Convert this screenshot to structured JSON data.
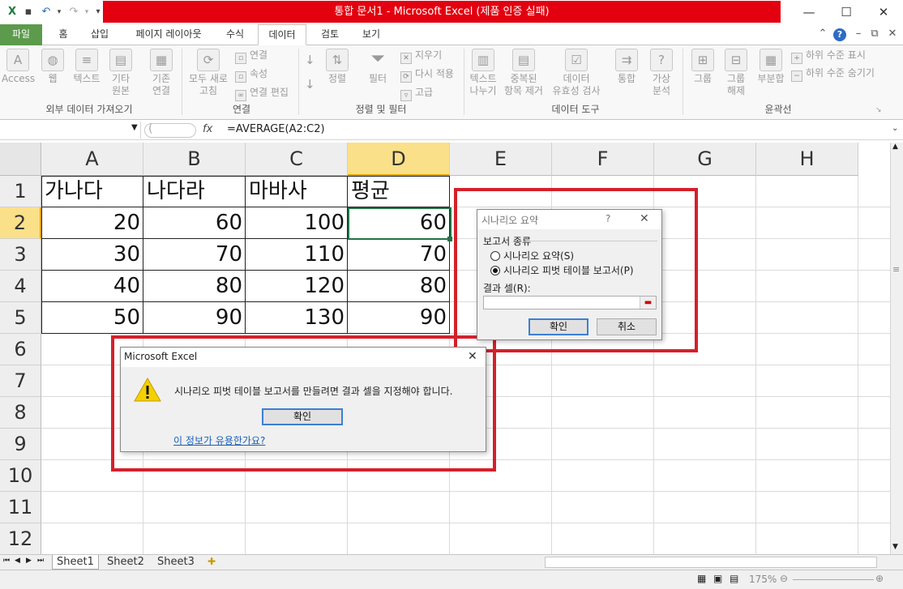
{
  "window": {
    "title": "통합 문서1 - Microsoft Excel (제품 인증 실패)",
    "qat_icons": [
      "excel-icon",
      "save-icon",
      "undo-icon",
      "redo-icon",
      "customize-icon"
    ],
    "controls": [
      "minimize",
      "restore",
      "close"
    ]
  },
  "tabs": {
    "file": "파일",
    "items": [
      "홈",
      "삽입",
      "페이지 레이아웃",
      "수식",
      "데이터",
      "검토",
      "보기"
    ],
    "active": "데이터"
  },
  "ribbon": {
    "external_data": {
      "group": "외부 데이터 가져오기",
      "access": "Access",
      "web": "웹",
      "text": "텍스트",
      "other_1": "기타",
      "other_2": "원본"
    },
    "connections": {
      "group": "연결",
      "existing_1": "기존",
      "existing_2": "연결",
      "refresh_1": "모두 새로",
      "refresh_2": "고침",
      "connections": "연결",
      "properties": "속성",
      "edit_links": "연결 편집"
    },
    "sort_filter": {
      "group": "정렬 및 필터",
      "sort": "정렬",
      "filter": "필터",
      "clear": "지우기",
      "reapply": "다시 적용",
      "advanced": "고급"
    },
    "data_tools": {
      "group": "데이터 도구",
      "text_to_cols_1": "텍스트",
      "text_to_cols_2": "나누기",
      "remove_dup_1": "중복된",
      "remove_dup_2": "항목 제거",
      "validation_1": "데이터",
      "validation_2": "유효성 검사",
      "consolidate": "통합",
      "whatif_1": "가상",
      "whatif_2": "분석"
    },
    "outline": {
      "group": "윤곽선",
      "group_btn": "그룹",
      "ungroup_1": "그룹",
      "ungroup_2": "해제",
      "subtotal": "부분합",
      "show_detail": "하위 수준 표시",
      "hide_detail": "하위 수준 숨기기"
    }
  },
  "formula_bar": {
    "fx": "fx",
    "formula": "=AVERAGE(A2:C2)"
  },
  "sheet": {
    "columns": [
      "A",
      "B",
      "C",
      "D",
      "E",
      "F",
      "G",
      "H"
    ],
    "rows": [
      "1",
      "2",
      "3",
      "4",
      "5",
      "6",
      "7",
      "8",
      "9",
      "10",
      "11",
      "12"
    ],
    "headers": [
      "가나다",
      "나다라",
      "마바사",
      "평균"
    ],
    "data": [
      [
        "20",
        "60",
        "100",
        "60"
      ],
      [
        "30",
        "70",
        "110",
        "70"
      ],
      [
        "40",
        "80",
        "120",
        "80"
      ],
      [
        "50",
        "90",
        "130",
        "90"
      ]
    ]
  },
  "sheet_tabs": [
    "Sheet1",
    "Sheet2",
    "Sheet3"
  ],
  "status": {
    "zoom": "175%"
  },
  "scenario_dialog": {
    "title": "시나리오 요약",
    "help": "?",
    "section": "보고서 종류",
    "option_summary": "시나리오 요약(S)",
    "option_pivot": "시나리오 피벗 테이블 보고서(P)",
    "selected": "pivot",
    "result_label": "결과 셀(R):",
    "result_value": "",
    "ok": "확인",
    "cancel": "취소"
  },
  "alert_dialog": {
    "title": "Microsoft Excel",
    "message": "시나리오 피벗 테이블 보고서를 만들려면 결과 셀을 지정해야 합니다.",
    "ok": "확인",
    "link": "이 정보가 유용한가요?"
  }
}
